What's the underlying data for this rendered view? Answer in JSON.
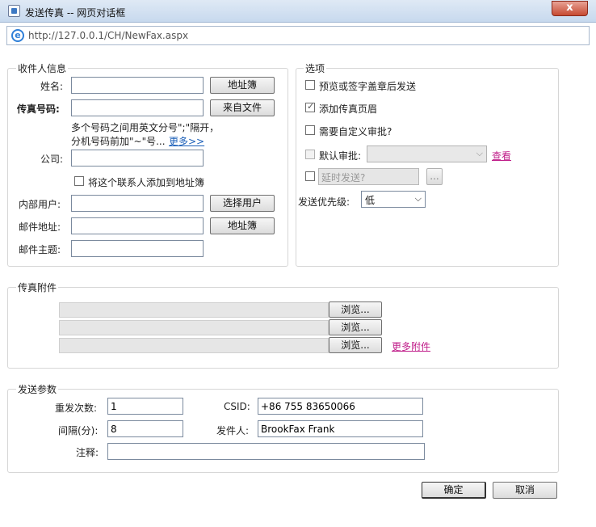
{
  "window": {
    "title": "发送传真 -- 网页对话框",
    "close_label": "x",
    "url": "http://127.0.0.1/CH/NewFax.aspx"
  },
  "recipient": {
    "legend": "收件人信息",
    "name_label": "姓名:",
    "name_value": "",
    "address_book_button": "地址簿",
    "fax_label": "传真号码:",
    "fax_value": "",
    "from_file_button": "来自文件",
    "hint_line1": "多个号码之间用英文分号\";\"隔开，",
    "hint_line2": "分机号码前加\"~\"号...",
    "more_link": "更多>>",
    "company_label": "公司:",
    "company_value": "",
    "add_contact_label": "将这个联系人添加到地址簿",
    "internal_user_label": "内部用户:",
    "select_user_button": "选择用户",
    "email_label": "邮件地址:",
    "email_address_book_button": "地址簿",
    "subject_label": "邮件主题:"
  },
  "options": {
    "legend": "选项",
    "preview_label": "预览或签字盖章后发送",
    "cover_label": "添加传真页眉",
    "custom_approval_label": "需要自定义审批?",
    "default_approval_label": "默认审批:",
    "view_link": "查看",
    "delayed_send_placeholder": "延时发送?",
    "ellipsis_button": "...",
    "priority_label": "发送优先级:",
    "priority_value": "低"
  },
  "attachments": {
    "legend": "传真附件",
    "browse_label": "浏览...",
    "more_attachments_link": "更多附件"
  },
  "params": {
    "legend": "发送参数",
    "retry_label": "重发次数:",
    "retry_value": "1",
    "csid_label": "CSID:",
    "csid_value": "+86 755 83650066",
    "interval_label": "间隔(分):",
    "interval_value": "8",
    "sender_label": "发件人:",
    "sender_value": "BrookFax Frank",
    "remark_label": "注释:",
    "remark_value": ""
  },
  "footer": {
    "ok_button": "确定",
    "cancel_button": "取消"
  },
  "colors": {
    "link_magenta": "#c01e8a",
    "link_blue": "#1b5fb8",
    "close_red": "#c64a32"
  }
}
